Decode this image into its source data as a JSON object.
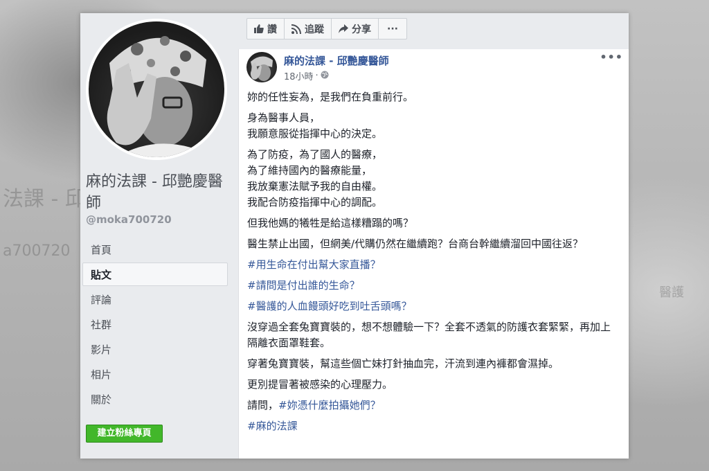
{
  "page": {
    "name": "麻的法課 - 邱艷慶醫師",
    "handle": "@moka700720",
    "create_button": "建立粉絲專頁"
  },
  "nav": [
    "首頁",
    "貼文",
    "評論",
    "社群",
    "影片",
    "相片",
    "關於"
  ],
  "actions": {
    "like": "讚",
    "follow": "追蹤",
    "share": "分享",
    "more": "···"
  },
  "post": {
    "author": "麻的法課 - 邱艷慶醫師",
    "time": "18小時",
    "more": "•••",
    "lines": {
      "p1": "妳的任性妄為，是我們在負重前行。",
      "p2a": "身為醫事人員，",
      "p2b": "我願意服從指揮中心的決定。",
      "p3a": "為了防疫，為了國人的醫療，",
      "p3b": "為了維持國內的醫療能量，",
      "p3c": "我放棄憲法賦予我的自由權。",
      "p3d": "我配合防疫指揮中心的調配。",
      "p4": "但我他媽的犧牲是給這樣糟蹋的嗎？",
      "p5": "醫生禁止出國，但網美/代購仍然在繼續跑？台商台幹繼續溜回中國往返？",
      "p6": "#用生命在付出幫大家直播？",
      "p7": "#請問是付出誰的生命？",
      "p8": "#醫護的人血饅頭好吃到吐舌頭嗎？",
      "p9": "沒穿過全套兔寶寶裝的，想不想體驗一下？全套不透氣的防護衣套緊緊，再加上隔離衣面罩鞋套。",
      "p10": "穿著兔寶寶裝，幫這些個亡妹打針抽血完，汗流到連內褲都會濕掉。",
      "p11": "更別提冒著被感染的心理壓力。",
      "p12_prefix": "請問，",
      "p12_tag": "#妳憑什麼拍攝她們？",
      "p13": "#麻的法課"
    }
  },
  "background_text": {
    "left_big": "法課 - 邱",
    "left_small": "a700720",
    "right": "醫護"
  },
  "colors": {
    "link": "#365899",
    "green": "#42b72a",
    "panel": "#e9ebee"
  }
}
